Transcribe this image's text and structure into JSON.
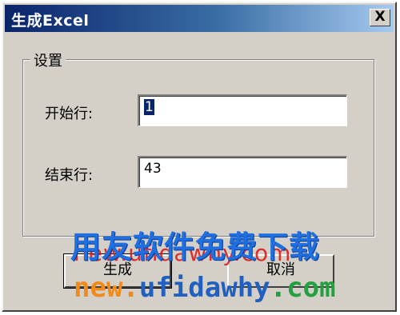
{
  "window": {
    "title": "生成Excel",
    "close_glyph": "X"
  },
  "group": {
    "legend": "设置"
  },
  "fields": {
    "start_row_label": "开始行:",
    "start_row_value": "1",
    "end_row_label": "结束行:",
    "end_row_value": "43"
  },
  "buttons": {
    "generate_label": "生成",
    "cancel_label": "取消"
  },
  "watermark": {
    "red_text": "new.ufidawhy.com",
    "blue_text": "用友软件免费下载",
    "bottom_part1": "new.",
    "bottom_part2": "ufidawhy",
    "bottom_part3": ".com"
  },
  "colors": {
    "titlebar_start": "#0a246a",
    "titlebar_end": "#a6caf0",
    "dialog_bg": "#d4d0c8",
    "watermark_blue": "#1f6fe0",
    "watermark_red": "#e01010",
    "watermark_orange": "#f08a1a",
    "watermark_green": "#24a040"
  }
}
